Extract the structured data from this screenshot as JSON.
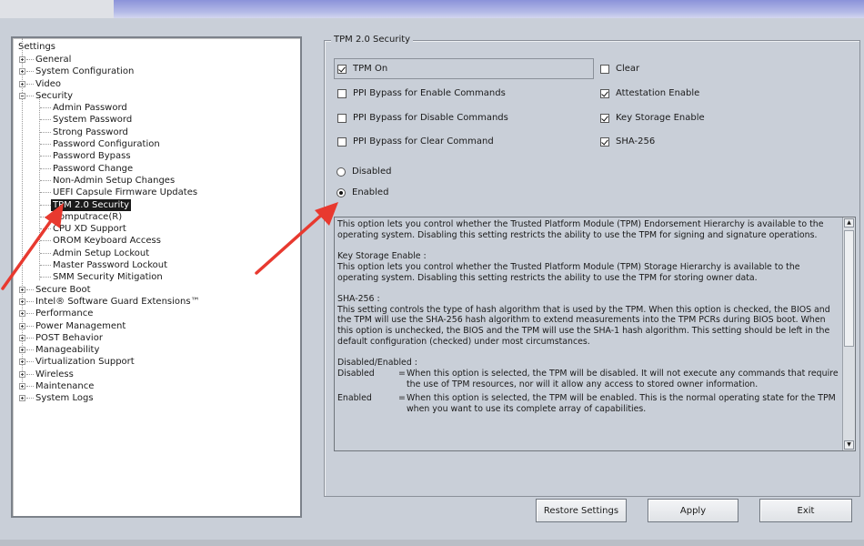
{
  "tree": {
    "root_label": "Settings",
    "items": [
      {
        "label": "General",
        "level": 0,
        "expander": "plus"
      },
      {
        "label": "System Configuration",
        "level": 0,
        "expander": "plus"
      },
      {
        "label": "Video",
        "level": 0,
        "expander": "plus"
      },
      {
        "label": "Security",
        "level": 0,
        "expander": "minus"
      },
      {
        "label": "Admin Password",
        "level": 1
      },
      {
        "label": "System Password",
        "level": 1
      },
      {
        "label": "Strong Password",
        "level": 1
      },
      {
        "label": "Password Configuration",
        "level": 1
      },
      {
        "label": "Password Bypass",
        "level": 1
      },
      {
        "label": "Password Change",
        "level": 1
      },
      {
        "label": "Non-Admin Setup Changes",
        "level": 1
      },
      {
        "label": "UEFI Capsule Firmware Updates",
        "level": 1
      },
      {
        "label": "TPM 2.0 Security",
        "level": 1,
        "selected": true
      },
      {
        "label": "Computrace(R)",
        "level": 1
      },
      {
        "label": "CPU XD Support",
        "level": 1
      },
      {
        "label": "OROM Keyboard Access",
        "level": 1
      },
      {
        "label": "Admin Setup Lockout",
        "level": 1
      },
      {
        "label": "Master Password Lockout",
        "level": 1
      },
      {
        "label": "SMM Security Mitigation",
        "level": 1
      },
      {
        "label": "Secure Boot",
        "level": 0,
        "expander": "plus"
      },
      {
        "label": "Intel® Software Guard Extensions™",
        "level": 0,
        "expander": "plus"
      },
      {
        "label": "Performance",
        "level": 0,
        "expander": "plus"
      },
      {
        "label": "Power Management",
        "level": 0,
        "expander": "plus"
      },
      {
        "label": "POST Behavior",
        "level": 0,
        "expander": "plus"
      },
      {
        "label": "Manageability",
        "level": 0,
        "expander": "plus"
      },
      {
        "label": "Virtualization Support",
        "level": 0,
        "expander": "plus"
      },
      {
        "label": "Wireless",
        "level": 0,
        "expander": "plus"
      },
      {
        "label": "Maintenance",
        "level": 0,
        "expander": "plus"
      },
      {
        "label": "System Logs",
        "level": 0,
        "expander": "plus"
      }
    ]
  },
  "group": {
    "title": "TPM 2.0 Security",
    "checkboxes": {
      "tpm_on": {
        "label": "TPM On",
        "checked": true
      },
      "clear": {
        "label": "Clear",
        "checked": false
      },
      "ppi_enable": {
        "label": "PPI Bypass for Enable Commands",
        "checked": false
      },
      "attestation": {
        "label": "Attestation Enable",
        "checked": true
      },
      "ppi_disable": {
        "label": "PPI Bypass for Disable Commands",
        "checked": false
      },
      "key_storage": {
        "label": "Key Storage Enable",
        "checked": true
      },
      "ppi_clear": {
        "label": "PPI Bypass for Clear Command",
        "checked": false
      },
      "sha256": {
        "label": "SHA-256",
        "checked": true
      }
    },
    "radios": {
      "disabled": {
        "label": "Disabled",
        "selected": false
      },
      "enabled": {
        "label": "Enabled",
        "selected": true
      }
    }
  },
  "description": {
    "attestation_text": "This option lets you control whether the Trusted Platform Module (TPM) Endorsement Hierarchy is available to the operating system.  Disabling this setting restricts the ability to use the TPM for signing and signature operations.",
    "key_storage_heading": "Key Storage Enable :",
    "key_storage_text": "This option lets you control whether the Trusted Platform Module (TPM) Storage Hierarchy is available to the operating system.  Disabling this setting restricts the ability to use the TPM for storing owner data.",
    "sha_heading": "SHA-256 :",
    "sha_text": "This setting controls the type of hash algorithm that is used by the TPM. When this option is checked, the BIOS and the TPM will use the SHA-256 hash algorithm to extend measurements into the TPM PCRs during BIOS boot. When this option is unchecked, the BIOS and the TPM will use the SHA-1 hash algorithm. This setting should be left in the default configuration (checked) under most circumstances.",
    "de_heading": "Disabled/Enabled :",
    "disabled_term": "Disabled",
    "disabled_text": "When this option is selected, the TPM will be disabled. It will not execute any commands that require the use of TPM resources, nor will it allow any access to stored owner information.",
    "enabled_term": "Enabled",
    "enabled_text": "When this option is selected, the TPM will be enabled. This is the normal operating state for the TPM when you want to use its complete array of capabilities.",
    "eq_sign": "="
  },
  "buttons": {
    "restore": "Restore Settings",
    "apply": "Apply",
    "exit": "Exit"
  },
  "colors": {
    "background": "#c9cfd8",
    "annotation_arrow": "#e8392f",
    "selection": "#1a1a1a"
  }
}
